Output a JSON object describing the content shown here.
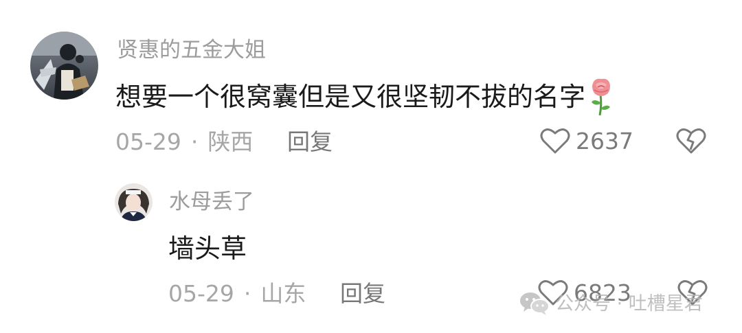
{
  "comment": {
    "username": "贤惠的五金大姐",
    "text": "想要一个很窝囊但是又很坚韧不拔的名字",
    "emoji_icon": "rose-icon",
    "date": "05-29",
    "separator": "·",
    "location": "陕西",
    "reply_label": "回复",
    "like_icon": "heart-outline-icon",
    "like_count": "2637",
    "dislike_icon": "broken-heart-icon"
  },
  "reply": {
    "username": "水母丢了",
    "text": "墙头草",
    "date": "05-29",
    "separator": "·",
    "location": "山东",
    "reply_label": "回复",
    "like_icon": "heart-outline-icon",
    "like_count": "6823",
    "dislike_icon": "broken-heart-icon"
  },
  "watermark": {
    "icon": "wechat-icon",
    "text": "公众号 · 吐槽星君"
  },
  "colors": {
    "background": "#ffffff",
    "username": "#9c9c9c",
    "content": "#1a1a1a",
    "meta": "#a6a6a6",
    "icon": "#7a7a7a"
  }
}
